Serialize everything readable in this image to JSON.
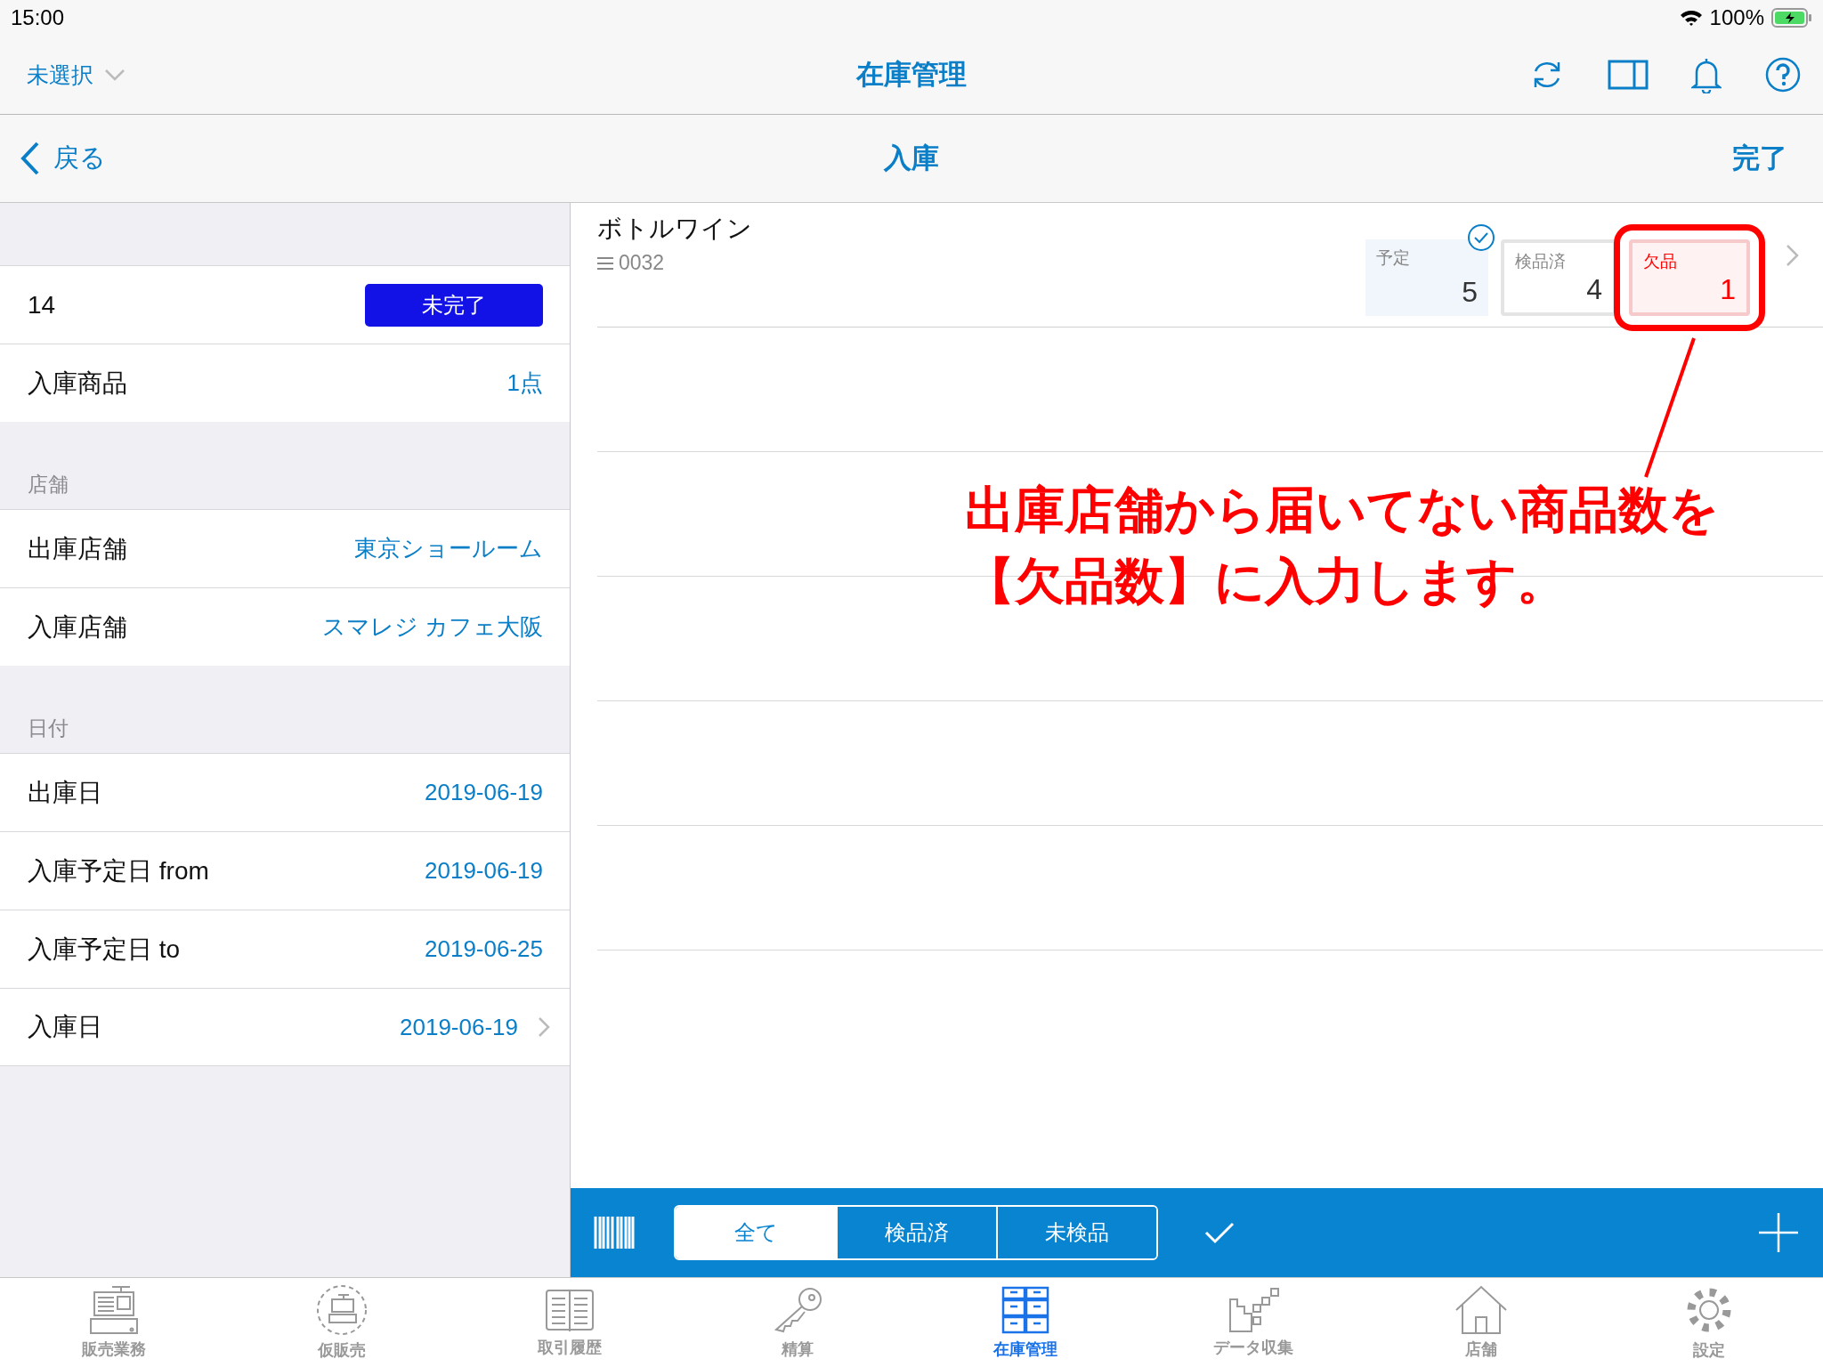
{
  "status_bar": {
    "time": "15:00",
    "battery_text": "100%"
  },
  "nav": {
    "store_selector": "未選択",
    "title": "在庫管理"
  },
  "subnav": {
    "back": "戻る",
    "title": "入庫",
    "done": "完了"
  },
  "sections": [
    {
      "rows": [
        {
          "kind": "status",
          "label": "14",
          "value": "未完了"
        },
        {
          "kind": "value",
          "label": "入庫商品",
          "value": "1点"
        }
      ]
    },
    {
      "header": "店舗",
      "rows": [
        {
          "kind": "value",
          "label": "出庫店舗",
          "value": "東京ショールーム"
        },
        {
          "kind": "value",
          "label": "入庫店舗",
          "value": "スマレジ カフェ大阪"
        }
      ]
    },
    {
      "header": "日付",
      "rows": [
        {
          "kind": "value",
          "label": "出庫日",
          "value": "2019-06-19"
        },
        {
          "kind": "value",
          "label": "入庫予定日 from",
          "value": "2019-06-19"
        },
        {
          "kind": "value",
          "label": "入庫予定日 to",
          "value": "2019-06-25"
        },
        {
          "kind": "link",
          "label": "入庫日",
          "value": "2019-06-19"
        }
      ]
    }
  ],
  "item": {
    "name": "ボトルワイン",
    "code": "0032",
    "counts": [
      {
        "kind": "planned",
        "label": "予定",
        "value": "5",
        "checked": true,
        "highlighted": false
      },
      {
        "kind": "inspected",
        "label": "検品済",
        "value": "4",
        "checked": false,
        "highlighted": false
      },
      {
        "kind": "missing",
        "label": "欠品",
        "value": "1",
        "checked": false,
        "highlighted": true
      }
    ]
  },
  "annotation": {
    "lines": [
      "出庫店舗から届いてない商品数を",
      "【欠品数】に入力します。"
    ]
  },
  "filter_segments": [
    {
      "label": "全て",
      "selected": true
    },
    {
      "label": "検品済",
      "selected": false
    },
    {
      "label": "未検品",
      "selected": false
    }
  ],
  "tab_bar": [
    {
      "kind": "register",
      "label": "販売業務",
      "selected": false
    },
    {
      "kind": "temp",
      "label": "仮販売",
      "selected": false
    },
    {
      "kind": "history",
      "label": "取引履歴",
      "selected": false
    },
    {
      "kind": "settle",
      "label": "精算",
      "selected": false
    },
    {
      "kind": "inventory",
      "label": "在庫管理",
      "selected": true
    },
    {
      "kind": "data",
      "label": "データ収集",
      "selected": false
    },
    {
      "kind": "store",
      "label": "店舗",
      "selected": false
    },
    {
      "kind": "settings",
      "label": "設定",
      "selected": false
    }
  ]
}
